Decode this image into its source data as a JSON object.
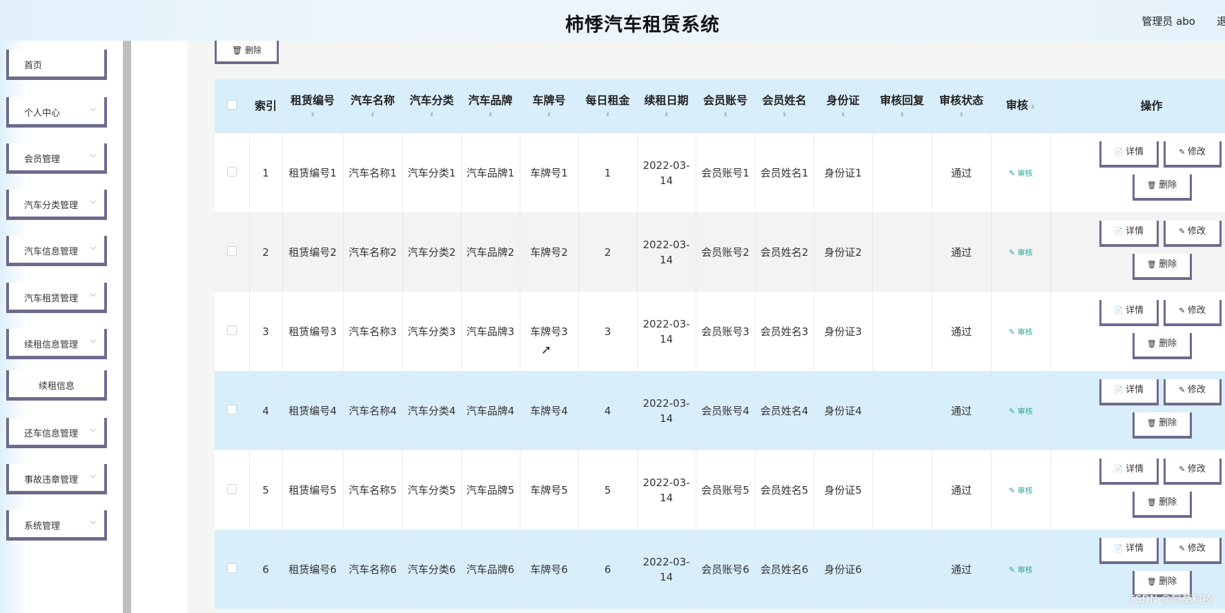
{
  "header": {
    "title": "柿悸汽车租赁系统",
    "admin": "管理员 abo",
    "logout": "退出登录"
  },
  "sidebar": {
    "items": [
      {
        "label": "首页",
        "chevron": false,
        "sub": false
      },
      {
        "label": "个人中心",
        "chevron": true,
        "sub": false
      },
      {
        "label": "会员管理",
        "chevron": true,
        "sub": false
      },
      {
        "label": "汽车分类管理",
        "chevron": true,
        "sub": false
      },
      {
        "label": "汽车信息管理",
        "chevron": true,
        "sub": false
      },
      {
        "label": "汽车租赁管理",
        "chevron": true,
        "sub": false
      },
      {
        "label": "续租信息管理",
        "chevron": true,
        "sub": false
      },
      {
        "label": "续租信息",
        "chevron": false,
        "sub": true
      },
      {
        "label": "还车信息管理",
        "chevron": true,
        "sub": false
      },
      {
        "label": "事故违章管理",
        "chevron": true,
        "sub": false
      },
      {
        "label": "系统管理",
        "chevron": true,
        "sub": false
      }
    ]
  },
  "toolbar": {
    "delete_label": "删除"
  },
  "table": {
    "headers": [
      "",
      "索引",
      "租赁编号",
      "汽车名称",
      "汽车分类",
      "汽车品牌",
      "车牌号",
      "每日租金",
      "续租日期",
      "会员账号",
      "会员姓名",
      "身份证",
      "审核回复",
      "审核状态",
      "审核",
      "操作"
    ],
    "rows": [
      {
        "index": "1",
        "rental_no": "租赁编号1",
        "car_name": "汽车名称1",
        "category": "汽车分类1",
        "brand": "汽车品牌1",
        "plate": "车牌号1",
        "daily_rent": "1",
        "renew_date": "2022-03-14",
        "member_account": "会员账号1",
        "member_name": "会员姓名1",
        "id_card": "身份证1",
        "review_reply": "",
        "review_status": "通过"
      },
      {
        "index": "2",
        "rental_no": "租赁编号2",
        "car_name": "汽车名称2",
        "category": "汽车分类2",
        "brand": "汽车品牌2",
        "plate": "车牌号2",
        "daily_rent": "2",
        "renew_date": "2022-03-14",
        "member_account": "会员账号2",
        "member_name": "会员姓名2",
        "id_card": "身份证2",
        "review_reply": "",
        "review_status": "通过"
      },
      {
        "index": "3",
        "rental_no": "租赁编号3",
        "car_name": "汽车名称3",
        "category": "汽车分类3",
        "brand": "汽车品牌3",
        "plate": "车牌号3",
        "daily_rent": "3",
        "renew_date": "2022-03-14",
        "member_account": "会员账号3",
        "member_name": "会员姓名3",
        "id_card": "身份证3",
        "review_reply": "",
        "review_status": "通过"
      },
      {
        "index": "4",
        "rental_no": "租赁编号4",
        "car_name": "汽车名称4",
        "category": "汽车分类4",
        "brand": "汽车品牌4",
        "plate": "车牌号4",
        "daily_rent": "4",
        "renew_date": "2022-03-14",
        "member_account": "会员账号4",
        "member_name": "会员姓名4",
        "id_card": "身份证4",
        "review_reply": "",
        "review_status": "通过"
      },
      {
        "index": "5",
        "rental_no": "租赁编号5",
        "car_name": "汽车名称5",
        "category": "汽车分类5",
        "brand": "汽车品牌5",
        "plate": "车牌号5",
        "daily_rent": "5",
        "renew_date": "2022-03-14",
        "member_account": "会员账号5",
        "member_name": "会员姓名5",
        "id_card": "身份证5",
        "review_reply": "",
        "review_status": "通过"
      },
      {
        "index": "6",
        "rental_no": "租赁编号6",
        "car_name": "汽车名称6",
        "category": "汽车分类6",
        "brand": "汽车品牌6",
        "plate": "车牌号6",
        "daily_rent": "6",
        "renew_date": "2022-03-14",
        "member_account": "会员账号6",
        "member_name": "会员姓名6",
        "id_card": "身份证6",
        "review_reply": "",
        "review_status": "通过"
      }
    ],
    "row_actions": {
      "review": "审核",
      "detail": "详情",
      "edit": "修改",
      "delete": "删除"
    }
  },
  "watermark": "CSDN @阿莫科技"
}
